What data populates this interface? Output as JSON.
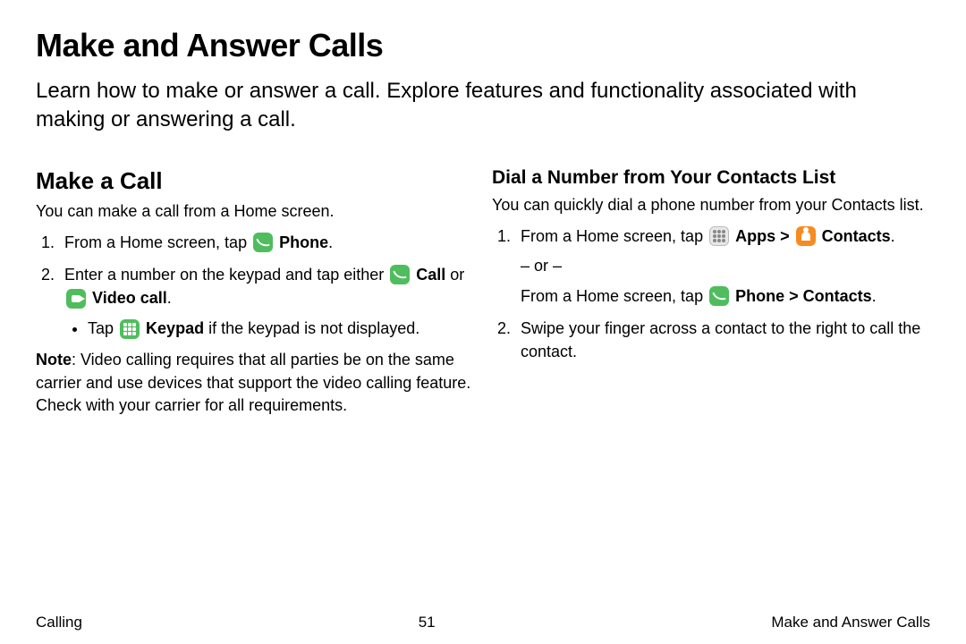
{
  "title": "Make and Answer Calls",
  "intro": "Learn how to make or answer a call. Explore features and functionality associated with making or answering a call.",
  "left": {
    "heading": "Make a Call",
    "lead": "You can make a call from a Home screen.",
    "step1_a": "From a Home screen, tap ",
    "step1_b": "Phone",
    "step1_c": ".",
    "step2_a": "Enter a number on the keypad and tap either ",
    "step2_b": "Call",
    "step2_or": " or ",
    "step2_c": "Video call",
    "step2_d": ".",
    "sub_a": "Tap ",
    "sub_b": "Keypad",
    "sub_c": " if the keypad is not displayed.",
    "note_label": "Note",
    "note_text": ": Video calling requires that all parties be on the same carrier and use devices that support the video calling feature. Check with your carrier for all requirements."
  },
  "right": {
    "heading": "Dial a Number from Your Contacts List",
    "lead": "You can quickly dial a phone number from your Contacts list.",
    "step1_a": "From a Home screen, tap ",
    "step1_b": "Apps",
    "step1_gt": " > ",
    "step1_c": "Contacts",
    "step1_d": ".",
    "or": "– or –",
    "alt_a": "From a Home screen, tap ",
    "alt_b": "Phone",
    "alt_gt": " > ",
    "alt_c": "Contacts",
    "alt_d": ".",
    "step2": "Swipe your finger across a contact to the right to call the contact."
  },
  "footer": {
    "left": "Calling",
    "center": "51",
    "right": "Make and Answer Calls"
  }
}
